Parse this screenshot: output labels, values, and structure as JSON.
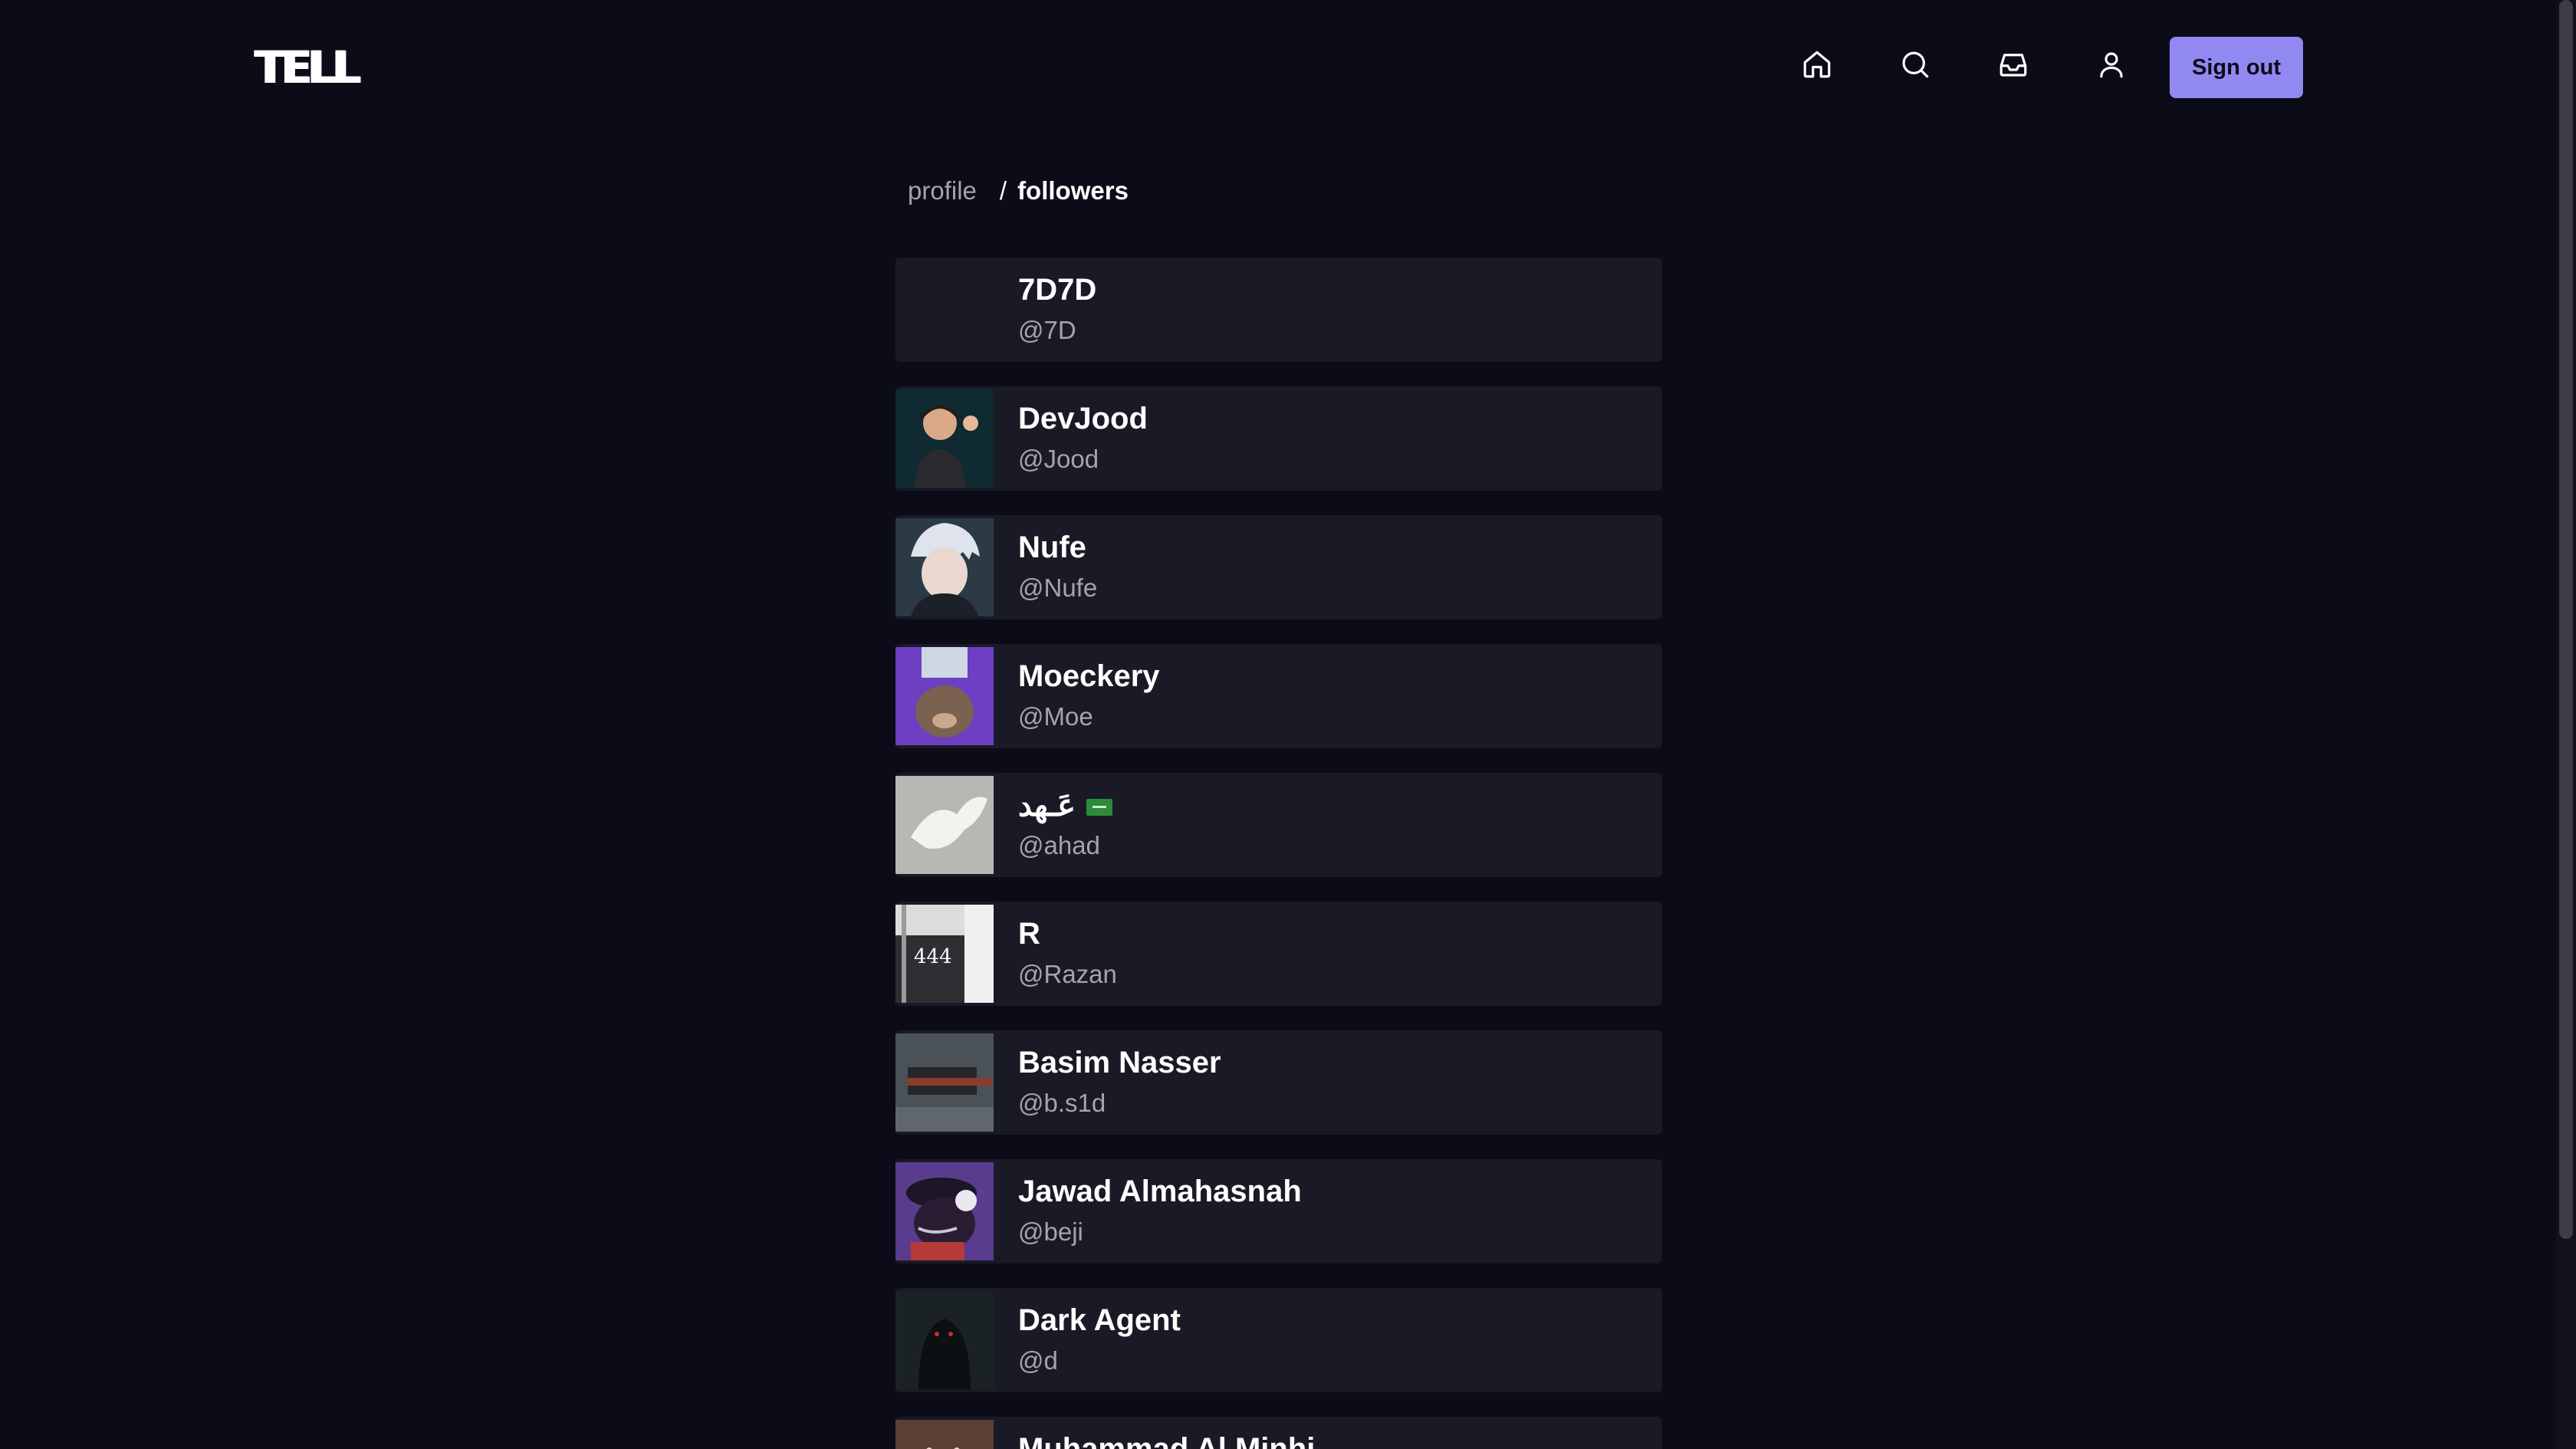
{
  "header": {
    "logo": "TELL",
    "nav": [
      {
        "name": "home-icon"
      },
      {
        "name": "search-icon"
      },
      {
        "name": "inbox-icon"
      },
      {
        "name": "user-icon"
      }
    ],
    "signout_label": "Sign out"
  },
  "breadcrumb": {
    "parent": "profile",
    "separator": "/",
    "current": "followers"
  },
  "followers": [
    {
      "name": "7D7D",
      "handle": "@7D"
    },
    {
      "name": "DevJood",
      "handle": "@Jood"
    },
    {
      "name": "Nufe",
      "handle": "@Nufe"
    },
    {
      "name": "Moeckery",
      "handle": "@Moe"
    },
    {
      "name": "عَـهد",
      "handle": "@ahad"
    },
    {
      "name": "R",
      "handle": "@Razan"
    },
    {
      "name": "Basim Nasser",
      "handle": "@b.s1d"
    },
    {
      "name": "Jawad Almahasnah",
      "handle": "@beji"
    },
    {
      "name": "Dark Agent",
      "handle": "@d"
    },
    {
      "name": "Muhammad Al Minhi",
      "handle": ""
    }
  ],
  "avatar_labels": {
    "razan_avatar_text": "444"
  },
  "colors": {
    "background": "#0b0c18",
    "row": "#1a1a26",
    "accent": "#9188f2",
    "muted_text": "#a4a4ad"
  }
}
